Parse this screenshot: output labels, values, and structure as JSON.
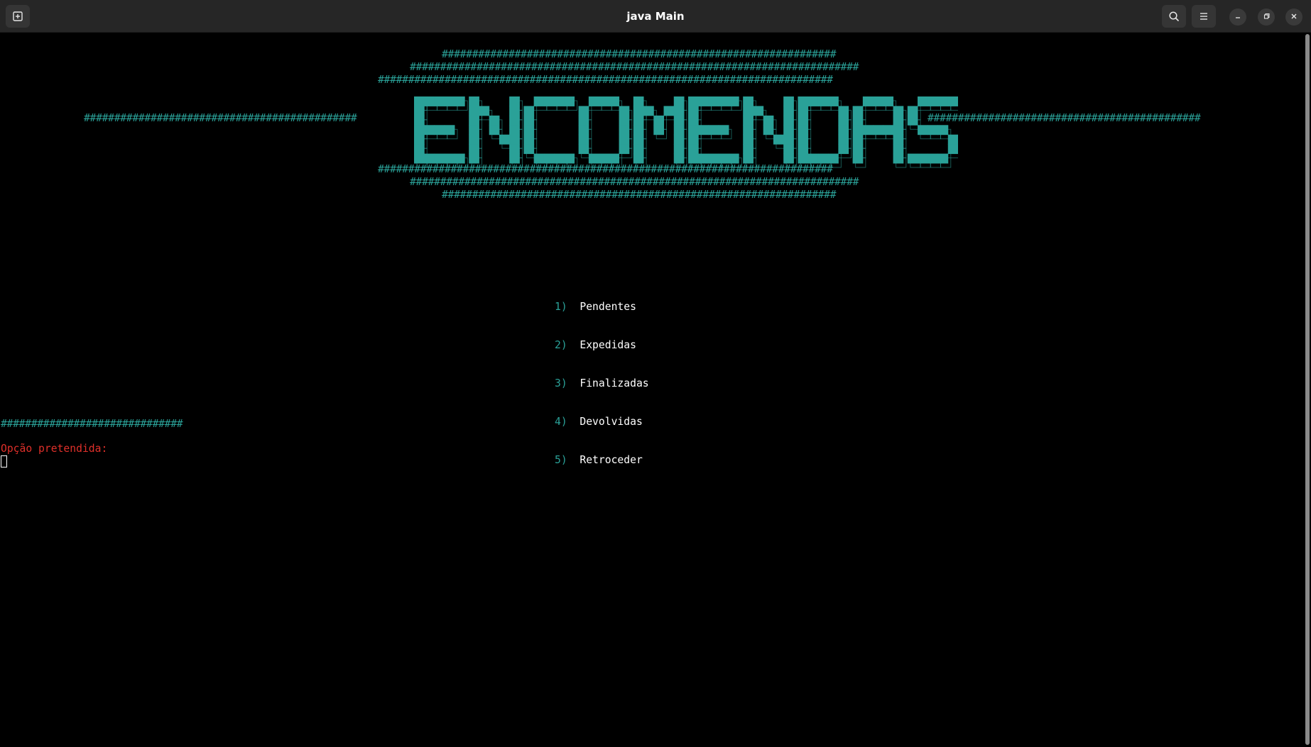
{
  "window": {
    "title": "java Main"
  },
  "titlebar": {
    "new_tab_icon": "new-tab-icon",
    "search_icon": "search-icon",
    "menu_icon": "hamburger-menu-icon",
    "minimize_icon": "minimize-icon",
    "maximize_icon": "maximize-icon",
    "close_icon": "close-icon"
  },
  "banner": {
    "word": "ENCOMENDAS",
    "hash_row_long": "###########################################################################",
    "hash_row_mid": "##########################################################################",
    "hash_row_short": "#################################################################",
    "side_left": "#############################################",
    "side_right": "#############################################",
    "color": "#2aa198"
  },
  "menu": {
    "items": [
      {
        "num": "1)",
        "label": "Pendentes"
      },
      {
        "num": "2)",
        "label": "Expedidas"
      },
      {
        "num": "3)",
        "label": "Finalizadas"
      },
      {
        "num": "4)",
        "label": "Devolvidas"
      },
      {
        "num": "5)",
        "label": "Retroceder"
      }
    ]
  },
  "footer": {
    "separator": "##############################",
    "prompt": "Opção pretendida:",
    "prompt_color": "#e0302a"
  }
}
